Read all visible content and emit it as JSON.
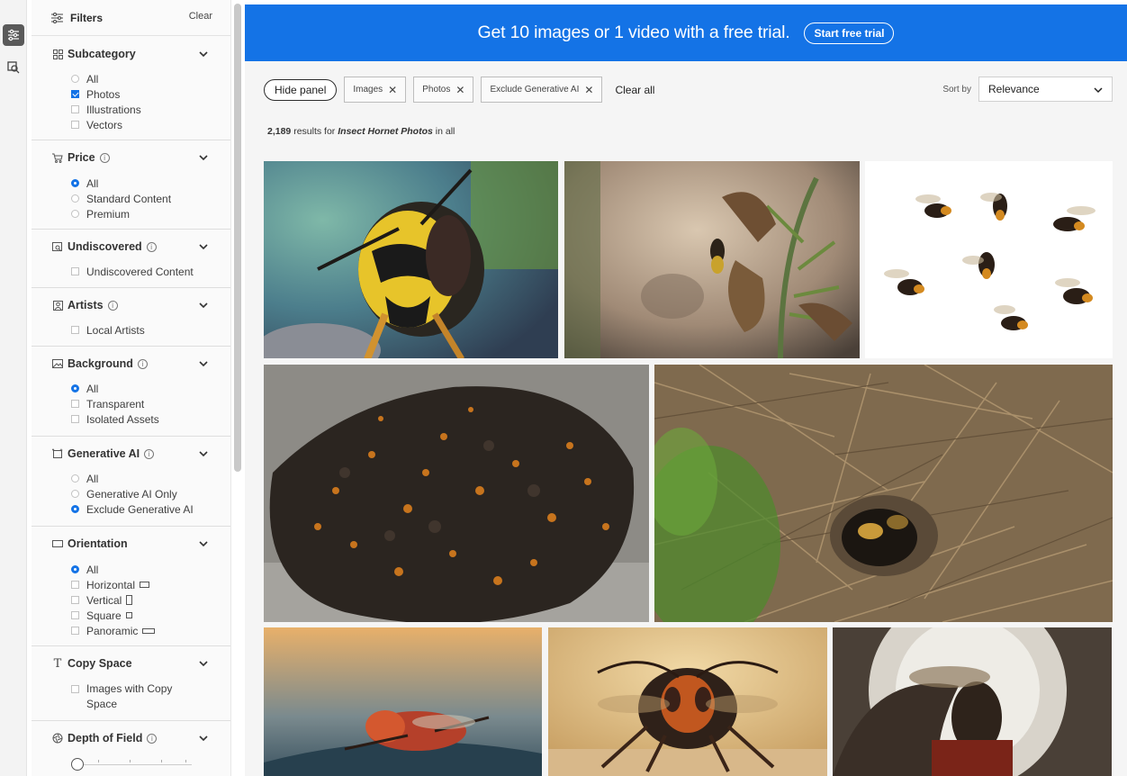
{
  "filters": {
    "title": "Filters",
    "clear": "Clear",
    "sections": {
      "subcategory": {
        "label": "Subcategory",
        "options": [
          "All",
          "Photos",
          "Illustrations",
          "Vectors"
        ]
      },
      "price": {
        "label": "Price",
        "options": [
          "All",
          "Standard Content",
          "Premium"
        ]
      },
      "undiscovered": {
        "label": "Undiscovered",
        "options": [
          "Undiscovered Content"
        ]
      },
      "artists": {
        "label": "Artists",
        "options": [
          "Local Artists"
        ]
      },
      "background": {
        "label": "Background",
        "options": [
          "All",
          "Transparent",
          "Isolated Assets"
        ]
      },
      "generative_ai": {
        "label": "Generative AI",
        "options": [
          "All",
          "Generative AI Only",
          "Exclude Generative AI"
        ]
      },
      "orientation": {
        "label": "Orientation",
        "options": [
          "All",
          "Horizontal",
          "Vertical",
          "Square",
          "Panoramic"
        ]
      },
      "copy_space": {
        "label": "Copy Space",
        "options": [
          "Images with Copy Space"
        ]
      },
      "depth_of_field": {
        "label": "Depth of Field"
      }
    },
    "selected": {
      "subcategory": "Photos",
      "price": "All",
      "background": "All",
      "generative_ai": "Exclude Generative AI",
      "orientation": "All"
    }
  },
  "banner": {
    "text": "Get 10 images or 1 video with a free trial.",
    "cta": "Start free trial"
  },
  "toolbar": {
    "hide_panel": "Hide panel",
    "chips": [
      "Images",
      "Photos",
      "Exclude Generative AI"
    ],
    "clear_all": "Clear all",
    "sort_label": "Sort by",
    "sort_value": "Relevance"
  },
  "results": {
    "count": "2,189",
    "mid": "results for",
    "query": "Insect Hornet Photos",
    "suffix": "in all"
  },
  "colors": {
    "accent": "#1473e6"
  },
  "icons": [
    "filters-icon",
    "visual-search-icon",
    "chevron-down-icon",
    "close-icon",
    "info-icon"
  ]
}
